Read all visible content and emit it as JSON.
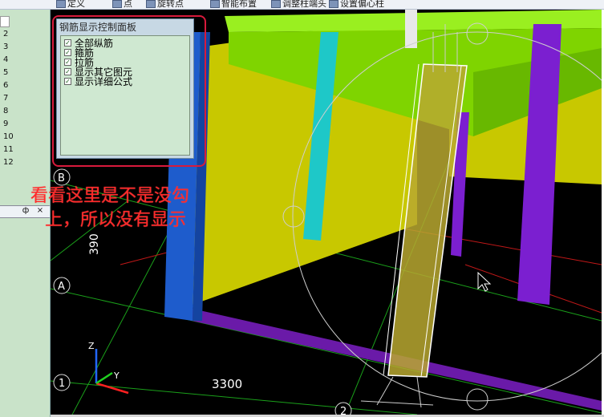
{
  "toolbar": {
    "items": [
      "定义",
      "点",
      "旋转点",
      "智能布置",
      "调整柱端头",
      "设置偏心柱"
    ]
  },
  "row_numbers": [
    "2",
    "3",
    "4",
    "5",
    "6",
    "7",
    "8",
    "9",
    "10",
    "11",
    "12"
  ],
  "pane_buttons": {
    "pin": "ф",
    "close": "×"
  },
  "panel": {
    "title": "钢筋显示控制面板",
    "options": [
      {
        "label": "全部纵筋",
        "checked": true
      },
      {
        "label": "箍筋",
        "checked": true
      },
      {
        "label": "拉筋",
        "checked": true
      },
      {
        "label": "显示其它图元",
        "checked": true
      },
      {
        "label": "显示详细公式",
        "checked": true
      }
    ]
  },
  "annotation": {
    "line1": "看看这里是不是没勾",
    "line2": "上，所以没有显示"
  },
  "viewport": {
    "axis_labels": {
      "B": "B",
      "A": "A",
      "one": "1",
      "two": "2"
    },
    "dimension_3300": "3300",
    "dimension_390": "390",
    "axes": {
      "z": "Z",
      "y": "Y"
    }
  },
  "colors": {
    "annotation": "#ff2a2a",
    "highlight_border": "#d81a3c",
    "beam_green": "#7fd400",
    "wall_yellow": "#c8c800",
    "column_purple": "#7b1fd0",
    "column_cyan": "#1ec8c8",
    "column_blue": "#1e5ccc"
  }
}
